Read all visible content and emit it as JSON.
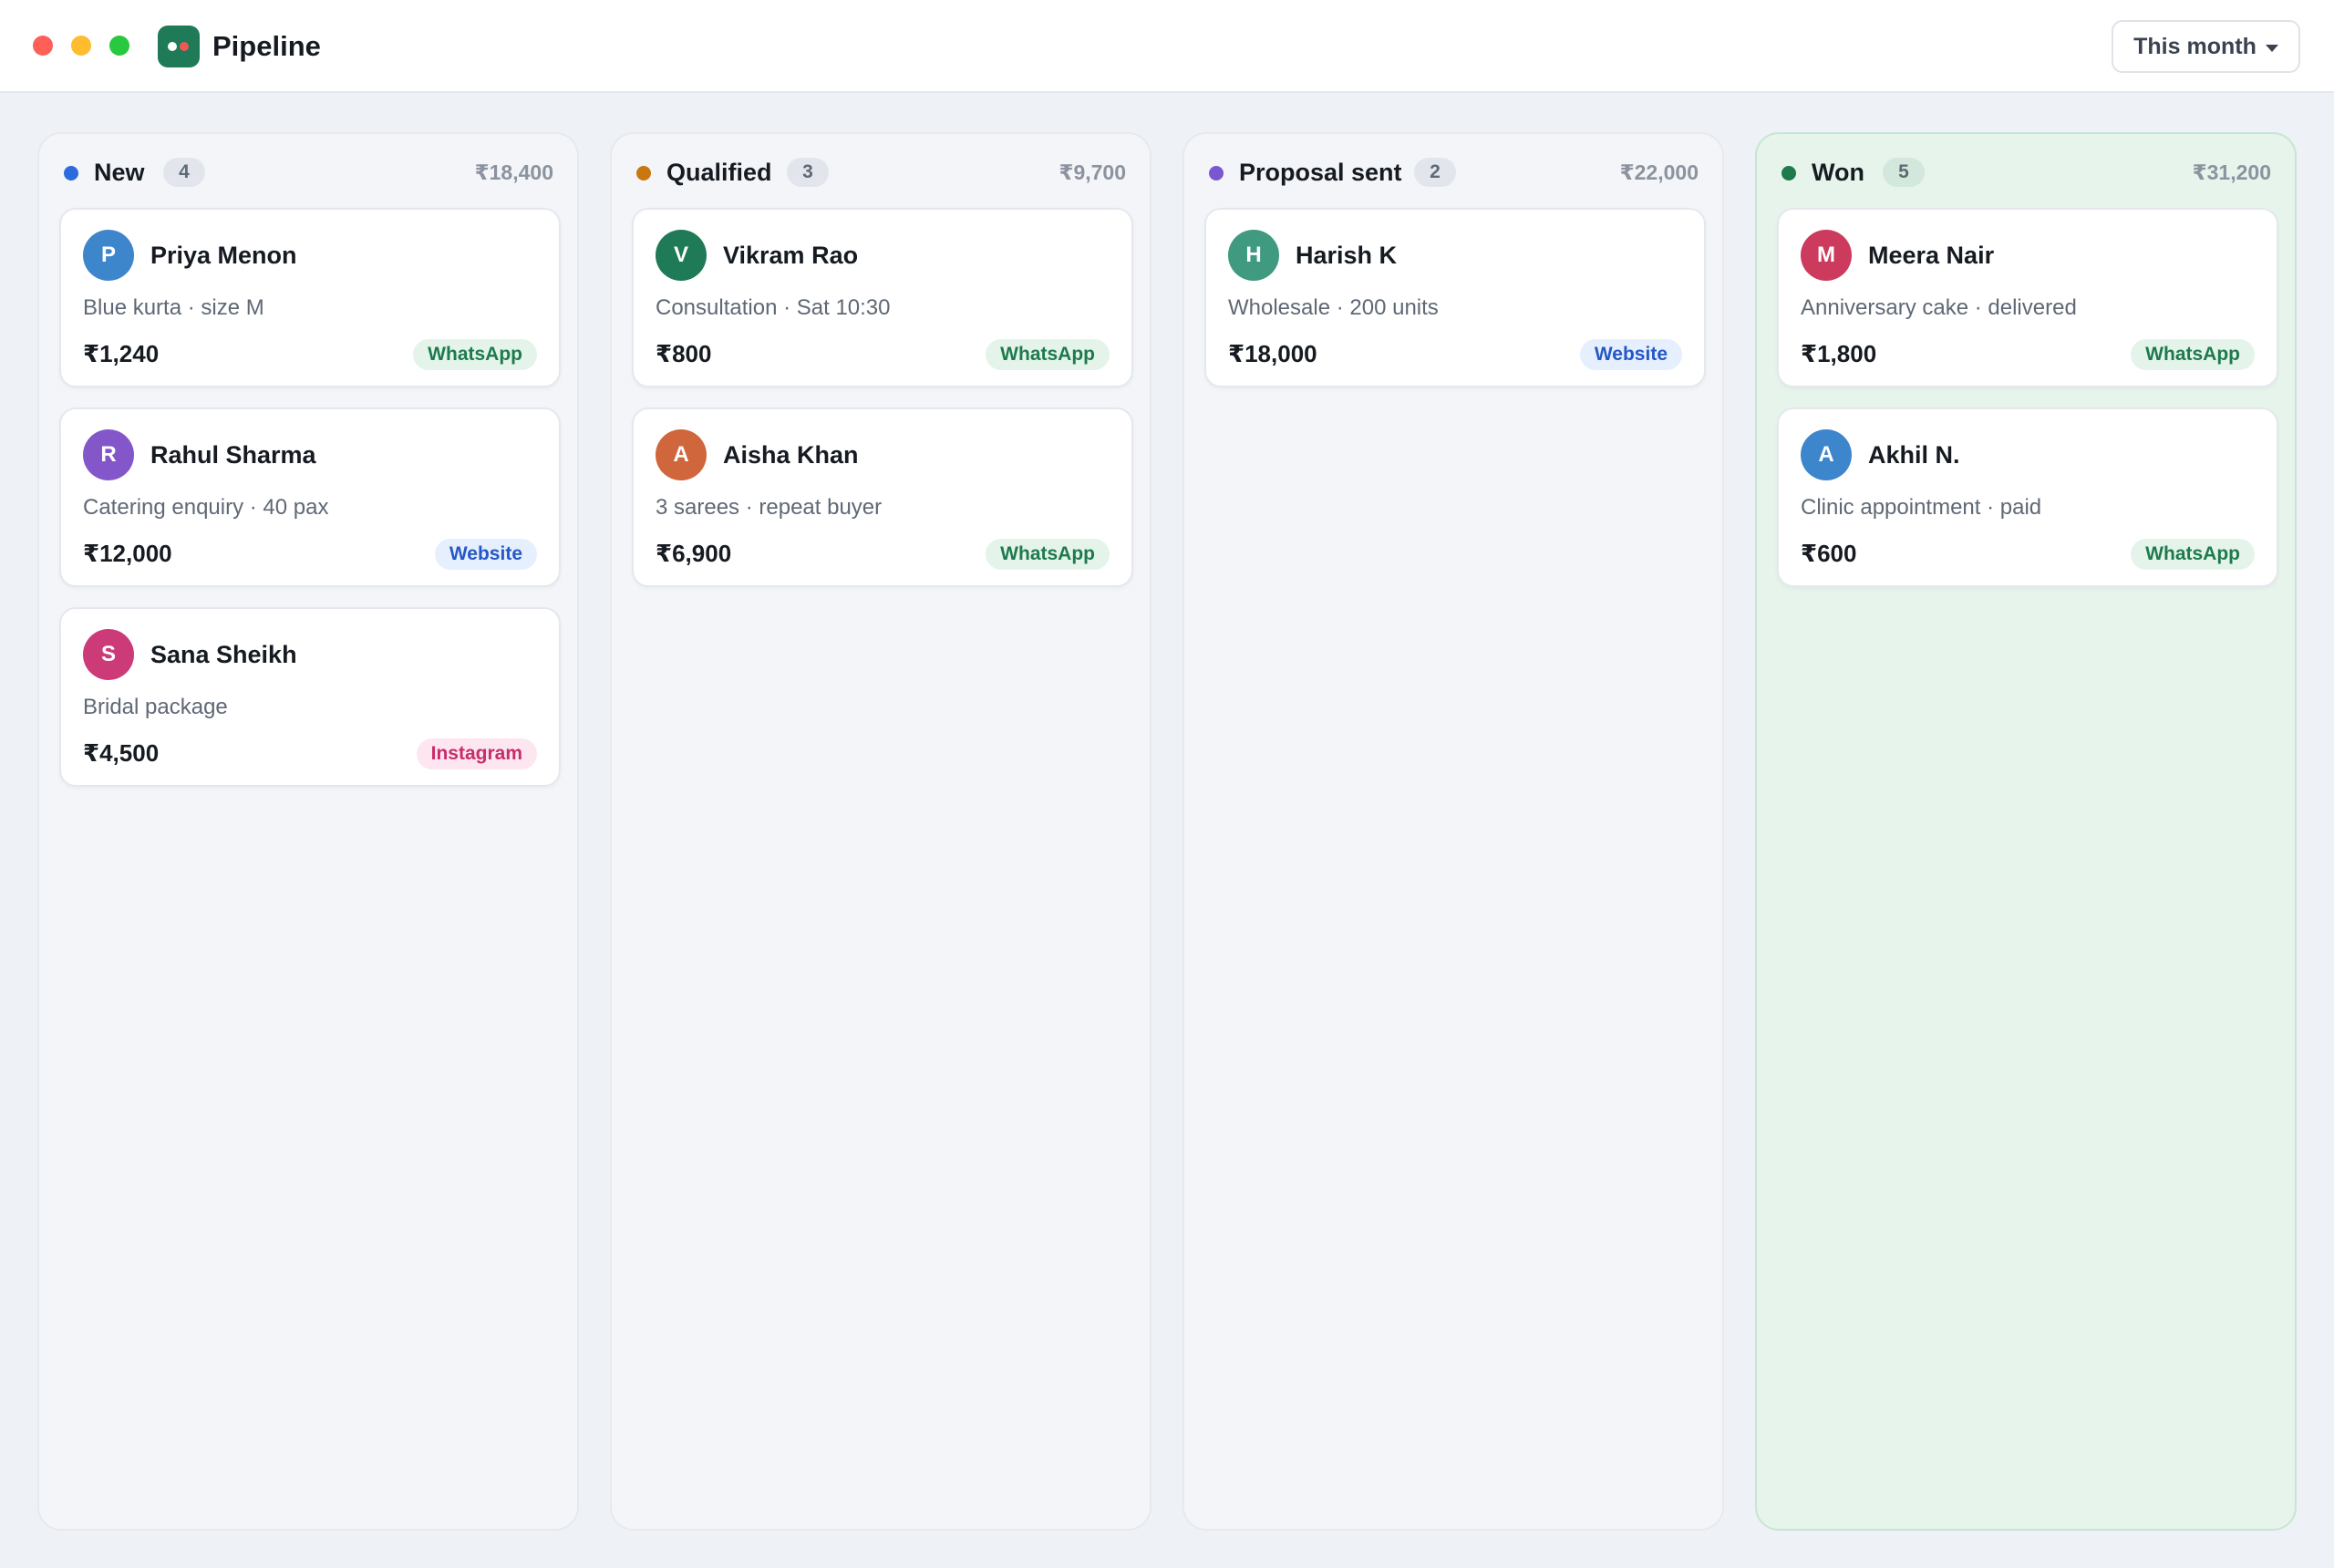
{
  "app": {
    "title": "Pipeline",
    "period_filter": "This month"
  },
  "colors": {
    "brand": "#1e7a57",
    "stage_new": "#2d6bdc",
    "stage_qualified": "#c9780f",
    "stage_proposal": "#7a57d1",
    "stage_won": "#1e7a4c"
  },
  "columns": [
    {
      "name": "New",
      "count": "4",
      "total": "₹18,400",
      "dot_color": "#2d6bdc",
      "cards": [
        {
          "initial": "P",
          "name": "Priya Menon",
          "desc": "Blue kurta · size M",
          "amount": "₹1,240",
          "channel": "WhatsApp",
          "avatar_color": "#3d86cc"
        },
        {
          "initial": "R",
          "name": "Rahul Sharma",
          "desc": "Catering enquiry · 40 pax",
          "amount": "₹12,000",
          "channel": "Website",
          "avatar_color": "#8357c9"
        },
        {
          "initial": "S",
          "name": "Sana Sheikh",
          "desc": "Bridal package",
          "amount": "₹4,500",
          "channel": "Instagram",
          "avatar_color": "#cc3a78"
        }
      ]
    },
    {
      "name": "Qualified",
      "count": "3",
      "total": "₹9,700",
      "dot_color": "#c9780f",
      "cards": [
        {
          "initial": "V",
          "name": "Vikram Rao",
          "desc": "Consultation · Sat 10:30",
          "amount": "₹800",
          "channel": "WhatsApp",
          "avatar_color": "#1e7a57"
        },
        {
          "initial": "A",
          "name": "Aisha Khan",
          "desc": "3 sarees · repeat buyer",
          "amount": "₹6,900",
          "channel": "WhatsApp",
          "avatar_color": "#d0663b"
        }
      ]
    },
    {
      "name": "Proposal sent",
      "count": "2",
      "total": "₹22,000",
      "dot_color": "#7a57d1",
      "cards": [
        {
          "initial": "H",
          "name": "Harish K",
          "desc": "Wholesale · 200 units",
          "amount": "₹18,000",
          "channel": "Website",
          "avatar_color": "#3f9a80"
        }
      ]
    },
    {
      "name": "Won",
      "count": "5",
      "total": "₹31,200",
      "dot_color": "#1e7a4c",
      "cards": [
        {
          "initial": "M",
          "name": "Meera Nair",
          "desc": "Anniversary cake · delivered",
          "amount": "₹1,800",
          "channel": "WhatsApp",
          "avatar_color": "#cc3a5e"
        },
        {
          "initial": "A",
          "name": "Akhil N.",
          "desc": "Clinic appointment · paid",
          "amount": "₹600",
          "channel": "WhatsApp",
          "avatar_color": "#3d86cc"
        }
      ]
    }
  ]
}
